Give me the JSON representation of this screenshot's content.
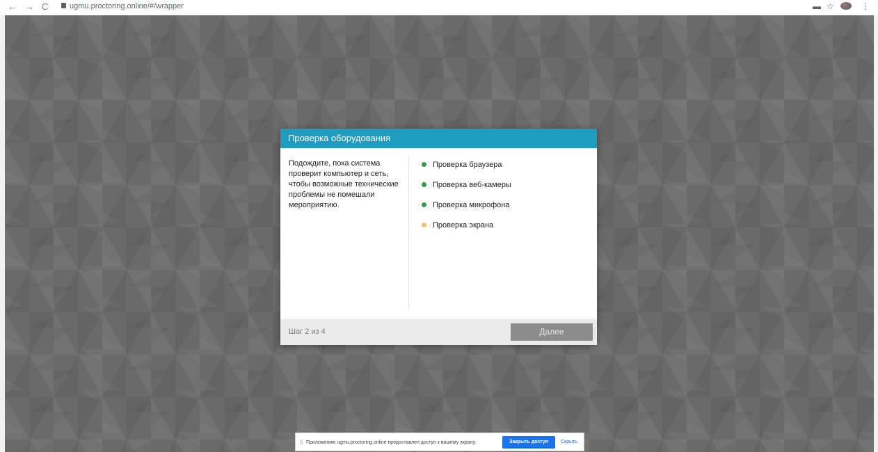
{
  "browser": {
    "back": "←",
    "forward": "→",
    "reload": "C",
    "url": "ugmu.proctoring.online/#/wrapper",
    "ext_icon": "▬",
    "star_icon": "☆",
    "menu_icon": "⋮"
  },
  "modal": {
    "title": "Проверка оборудования",
    "description": "Подождите, пока система проверит компьютер и сеть, чтобы возможные технические проблемы не помешали мероприятию.",
    "checks": [
      {
        "label": "Проверка браузера",
        "status_color": "#2e9e4a"
      },
      {
        "label": "Проверка веб-камеры",
        "status_color": "#2e9e4a"
      },
      {
        "label": "Проверка микрофона",
        "status_color": "#2e9e4a"
      },
      {
        "label": "Проверка экрана",
        "status_color": "#f5c26b"
      }
    ],
    "step": "Шаг 2 из 4",
    "next_label": "Далее"
  },
  "share_bar": {
    "grip": "||",
    "message": "Приложению ugmu.proctoring.online предоставлен доступ к вашему экрану.",
    "stop_label": "Закрыть доступ",
    "hide_label": "Скрыть"
  }
}
